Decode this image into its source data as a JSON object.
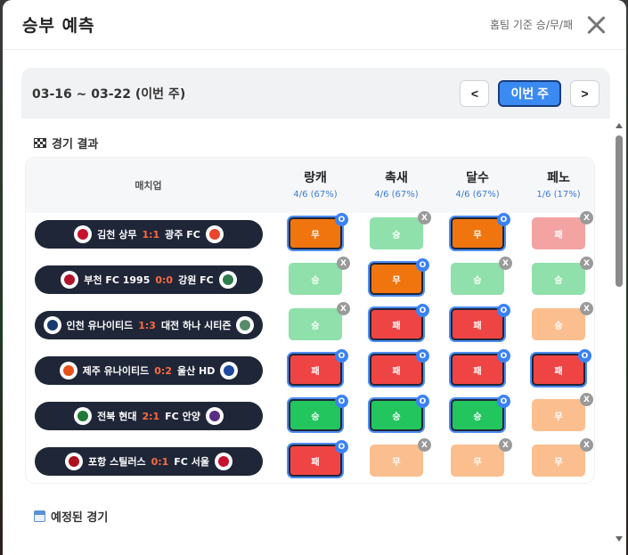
{
  "modal": {
    "title": "승부 예측",
    "hint": "홈팀 기준 승/무/패"
  },
  "week": {
    "label": "03-16 ~ 03-22 (이번 주)",
    "prev": "<",
    "current": "이번 주",
    "next": ">"
  },
  "sections": {
    "results": "경기 결과",
    "upcoming": "예정된 경기"
  },
  "table": {
    "match_header": "매치업",
    "users": [
      {
        "name": "랑캐",
        "stat": "4/6 (67%)"
      },
      {
        "name": "촉새",
        "stat": "4/6 (67%)"
      },
      {
        "name": "달수",
        "stat": "4/6 (67%)"
      },
      {
        "name": "페노",
        "stat": "1/6 (17%)"
      }
    ],
    "rows": [
      {
        "home": "김천 상무",
        "score": "1:1",
        "away": "광주 FC",
        "home_color": "#c8102e",
        "away_color": "#e8452c",
        "picks": [
          {
            "label": "무",
            "style": "c-mu",
            "sel": true,
            "badge": "O"
          },
          {
            "label": "승",
            "style": "c-win-light",
            "sel": false,
            "badge": "X"
          },
          {
            "label": "무",
            "style": "c-mu",
            "sel": true,
            "badge": "O"
          },
          {
            "label": "패",
            "style": "c-lose-light",
            "sel": false,
            "badge": "X"
          }
        ]
      },
      {
        "home": "부천 FC 1995",
        "score": "0:0",
        "away": "강원 FC",
        "home_color": "#b0142a",
        "away_color": "#2e7d4f",
        "picks": [
          {
            "label": "승",
            "style": "c-win-light",
            "sel": false,
            "badge": "X"
          },
          {
            "label": "무",
            "style": "c-mu",
            "sel": true,
            "badge": "O"
          },
          {
            "label": "승",
            "style": "c-win-light",
            "sel": false,
            "badge": "X"
          },
          {
            "label": "승",
            "style": "c-win-light",
            "sel": false,
            "badge": "X"
          }
        ]
      },
      {
        "home": "인천 유나이티드",
        "score": "1:3",
        "away": "대전 하나 시티즌",
        "home_color": "#1b3b6f",
        "away_color": "#5a8a6a",
        "picks": [
          {
            "label": "승",
            "style": "c-win-light",
            "sel": false,
            "badge": "X"
          },
          {
            "label": "패",
            "style": "c-lose",
            "sel": true,
            "badge": "O"
          },
          {
            "label": "패",
            "style": "c-lose",
            "sel": true,
            "badge": "O"
          },
          {
            "label": "승",
            "style": "c-peach",
            "sel": false,
            "badge": "X"
          }
        ]
      },
      {
        "home": "제주 유나이티드",
        "score": "0:2",
        "away": "울산 HD",
        "home_color": "#e8501c",
        "away_color": "#1d4aa0",
        "picks": [
          {
            "label": "패",
            "style": "c-lose",
            "sel": true,
            "badge": "O"
          },
          {
            "label": "패",
            "style": "c-lose",
            "sel": true,
            "badge": "O"
          },
          {
            "label": "패",
            "style": "c-lose",
            "sel": true,
            "badge": "O"
          },
          {
            "label": "패",
            "style": "c-lose",
            "sel": true,
            "badge": "O"
          }
        ]
      },
      {
        "home": "전북 현대",
        "score": "2:1",
        "away": "FC 안양",
        "home_color": "#1f7a3a",
        "away_color": "#5b2c83",
        "picks": [
          {
            "label": "승",
            "style": "c-win",
            "sel": true,
            "badge": "O"
          },
          {
            "label": "승",
            "style": "c-win",
            "sel": true,
            "badge": "O"
          },
          {
            "label": "승",
            "style": "c-win",
            "sel": true,
            "badge": "O"
          },
          {
            "label": "무",
            "style": "c-peach",
            "sel": false,
            "badge": "X"
          }
        ]
      },
      {
        "home": "포항 스틸러스",
        "score": "0:1",
        "away": "FC 서울",
        "home_color": "#b0101e",
        "away_color": "#c8102e",
        "picks": [
          {
            "label": "패",
            "style": "c-lose",
            "sel": true,
            "badge": "O"
          },
          {
            "label": "무",
            "style": "c-peach",
            "sel": false,
            "badge": "X"
          },
          {
            "label": "무",
            "style": "c-peach",
            "sel": false,
            "badge": "X"
          },
          {
            "label": "무",
            "style": "c-peach",
            "sel": false,
            "badge": "X"
          }
        ]
      }
    ]
  }
}
